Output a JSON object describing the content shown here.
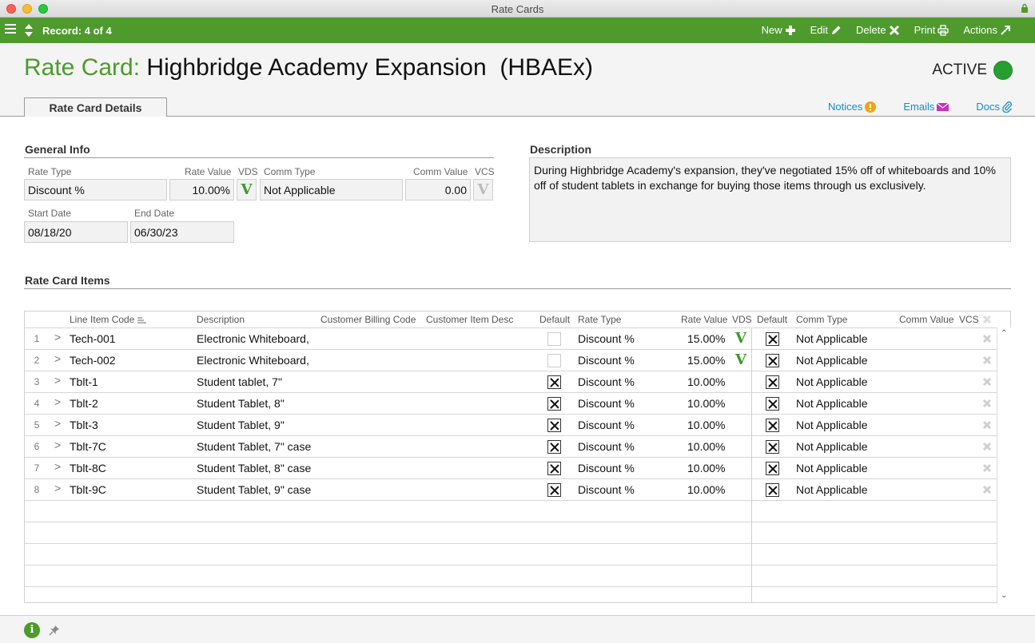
{
  "window": {
    "title": "Rate Cards"
  },
  "toolbar": {
    "record": "Record: 4 of 4",
    "actions": [
      {
        "label": "New",
        "icon": "plus-icon"
      },
      {
        "label": "Edit",
        "icon": "pencil-icon"
      },
      {
        "label": "Delete",
        "icon": "x-icon"
      },
      {
        "label": "Print",
        "icon": "printer-icon"
      },
      {
        "label": "Actions",
        "icon": "arrow-out-icon"
      }
    ]
  },
  "header": {
    "title_label": "Rate Card:",
    "title_value": "Highbridge Academy Expansion  (HBAEx)",
    "status": "ACTIVE",
    "tab": "Rate Card Details",
    "links": {
      "notices": "Notices",
      "emails": "Emails",
      "docs": "Docs"
    }
  },
  "general_info": {
    "title": "General Info",
    "labels": {
      "rate_type": "Rate Type",
      "rate_value": "Rate Value",
      "vds": "VDS",
      "comm_type": "Comm Type",
      "comm_value": "Comm Value",
      "vcs": "VCS",
      "start_date": "Start Date",
      "end_date": "End Date"
    },
    "rate_type": "Discount %",
    "rate_value": "10.00%",
    "vds": "V",
    "comm_type": "Not Applicable",
    "comm_value": "0.00",
    "vcs": "V",
    "start_date": "08/18/20",
    "end_date": "06/30/23"
  },
  "description": {
    "title": "Description",
    "text": "During Highbridge Academy's expansion, they've negotiated 15% off of whiteboards and 10% off of student tablets in exchange for buying those items through us exclusively."
  },
  "items": {
    "title": "Rate Card Items",
    "columns": {
      "line_item_code": "Line Item Code",
      "description": "Description",
      "customer_billing_code": "Customer Billing Code",
      "customer_item_desc": "Customer Item Desc",
      "default": "Default",
      "rate_type": "Rate Type",
      "rate_value": "Rate Value",
      "vds": "VDS",
      "default2": "Default",
      "comm_type": "Comm Type",
      "comm_value": "Comm Value",
      "vcs": "VCS"
    },
    "rows": [
      {
        "n": "1",
        "code": "Tech-001",
        "desc": "Electronic Whiteboard,",
        "default": false,
        "rate_type": "Discount %",
        "rate_value": "15.00%",
        "vds": "V",
        "default2": true,
        "comm_type": "Not Applicable"
      },
      {
        "n": "2",
        "code": "Tech-002",
        "desc": "Electronic Whiteboard,",
        "default": false,
        "rate_type": "Discount %",
        "rate_value": "15.00%",
        "vds": "V",
        "default2": true,
        "comm_type": "Not Applicable"
      },
      {
        "n": "3",
        "code": "Tblt-1",
        "desc": "Student tablet, 7\"",
        "default": true,
        "rate_type": "Discount %",
        "rate_value": "10.00%",
        "vds": "",
        "default2": true,
        "comm_type": "Not Applicable"
      },
      {
        "n": "4",
        "code": "Tblt-2",
        "desc": "Student Tablet, 8\"",
        "default": true,
        "rate_type": "Discount %",
        "rate_value": "10.00%",
        "vds": "",
        "default2": true,
        "comm_type": "Not Applicable"
      },
      {
        "n": "5",
        "code": "Tblt-3",
        "desc": "Student Tablet, 9\"",
        "default": true,
        "rate_type": "Discount %",
        "rate_value": "10.00%",
        "vds": "",
        "default2": true,
        "comm_type": "Not Applicable"
      },
      {
        "n": "6",
        "code": "Tblt-7C",
        "desc": "Student Tablet, 7\" case",
        "default": true,
        "rate_type": "Discount %",
        "rate_value": "10.00%",
        "vds": "",
        "default2": true,
        "comm_type": "Not Applicable"
      },
      {
        "n": "7",
        "code": "Tblt-8C",
        "desc": "Student Tablet, 8\" case",
        "default": true,
        "rate_type": "Discount %",
        "rate_value": "10.00%",
        "vds": "",
        "default2": true,
        "comm_type": "Not Applicable"
      },
      {
        "n": "8",
        "code": "Tblt-9C",
        "desc": "Student Tablet, 9\" case",
        "default": true,
        "rate_type": "Discount %",
        "rate_value": "10.00%",
        "vds": "",
        "default2": true,
        "comm_type": "Not Applicable"
      }
    ]
  },
  "colors": {
    "brand_green": "#4e9a2d",
    "status_green": "#25a030",
    "link_blue": "#1a8acb",
    "notice_orange": "#f2a30f",
    "email_magenta": "#c72fc0"
  }
}
